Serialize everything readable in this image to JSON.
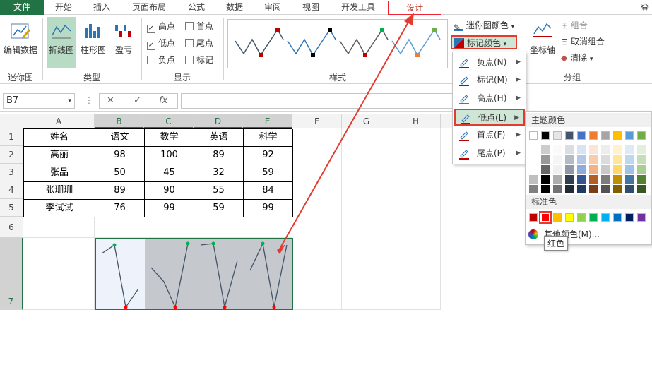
{
  "tabs": [
    "文件",
    "开始",
    "插入",
    "页面布局",
    "公式",
    "数据",
    "审阅",
    "视图",
    "开发工具",
    "设计"
  ],
  "login": "登",
  "ribbon": {
    "edit_data": "编辑数据",
    "group_sparkline": "迷你图",
    "type_line": "折线图",
    "type_column": "柱形图",
    "type_winloss": "盈亏",
    "group_type": "类型",
    "show": [
      {
        "label": "高点",
        "checked": true
      },
      {
        "label": "首点",
        "checked": false
      },
      {
        "label": "低点",
        "checked": true
      },
      {
        "label": "尾点",
        "checked": false
      },
      {
        "label": "负点",
        "checked": false
      },
      {
        "label": "标记",
        "checked": false
      }
    ],
    "group_show": "显示",
    "group_style": "样式",
    "sparkline_color": "迷你图颜色",
    "marker_color": "标记颜色",
    "axis": "坐标轴",
    "group": "组合",
    "ungroup": "取消组合",
    "clear": "清除",
    "group_group": "分组"
  },
  "formula_bar": {
    "name_box": "B7",
    "cancel": "✕",
    "enter": "✓",
    "fx": "fx",
    "value": ""
  },
  "columns": [
    "A",
    "B",
    "C",
    "D",
    "E",
    "F",
    "G",
    "H"
  ],
  "rows": [
    "1",
    "2",
    "3",
    "4",
    "5",
    "6",
    "7"
  ],
  "table": {
    "header": [
      "姓名",
      "语文",
      "数学",
      "英语",
      "科学"
    ],
    "rows": [
      [
        "高丽",
        "98",
        "100",
        "89",
        "92"
      ],
      [
        "张品",
        "50",
        "45",
        "32",
        "59"
      ],
      [
        "张珊珊",
        "89",
        "90",
        "55",
        "84"
      ],
      [
        "李试试",
        "76",
        "99",
        "59",
        "99"
      ]
    ]
  },
  "marker_menu": [
    {
      "label": "负点(N)",
      "color": "#c00000"
    },
    {
      "label": "标记(M)",
      "color": "#c00000"
    },
    {
      "label": "高点(H)",
      "color": "#00b050"
    },
    {
      "label": "低点(L)",
      "color": "#c00000"
    },
    {
      "label": "首点(F)",
      "color": "#c00000"
    },
    {
      "label": "尾点(P)",
      "color": "#c00000"
    }
  ],
  "palette": {
    "theme_title": "主题颜色",
    "standard_title": "标准色",
    "more_colors": "其他颜色(M)...",
    "tooltip": "红色",
    "theme_top": [
      "#ffffff",
      "#000000",
      "#e7e6e6",
      "#44546a",
      "#4472c4",
      "#ed7d31",
      "#a5a5a5",
      "#ffc000",
      "#5b9bd5",
      "#70ad47"
    ],
    "standard": [
      "#c00000",
      "#ff0000",
      "#ffc000",
      "#ffff00",
      "#92d050",
      "#00b050",
      "#00b0f0",
      "#0070c0",
      "#002060",
      "#7030a0"
    ]
  },
  "colors": {
    "excel_green": "#217346",
    "highlight_red": "#e23c2f",
    "spark_line": "#44546a",
    "spark_high": "#00b050",
    "spark_low": "#ff0000"
  }
}
